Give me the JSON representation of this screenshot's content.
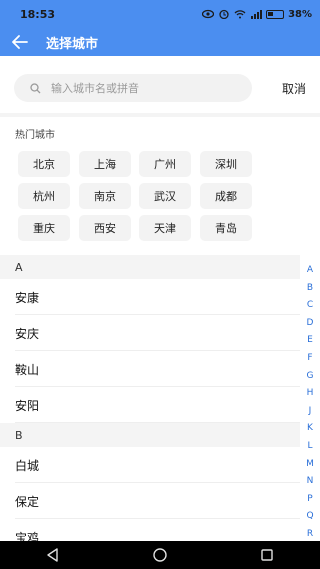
{
  "status_bar": {
    "time": "18:53",
    "battery": "38%",
    "icons": [
      "eye-icon",
      "alarm-icon",
      "wifi-icon",
      "signal-icon",
      "battery-icon"
    ]
  },
  "header": {
    "title": "选择城市",
    "back_icon": "arrow-left-icon",
    "background_color": "#4b8ef0"
  },
  "search": {
    "placeholder": "输入城市名或拼音",
    "value": "",
    "icon": "search-icon",
    "cancel_label": "取消"
  },
  "hot_cities": {
    "title": "热门城市",
    "items": [
      "北京",
      "上海",
      "广州",
      "深圳",
      "杭州",
      "南京",
      "武汉",
      "成都",
      "重庆",
      "西安",
      "天津",
      "青岛"
    ]
  },
  "sections": [
    {
      "letter": "A",
      "cities": [
        "安康",
        "安庆",
        "鞍山",
        "安阳"
      ]
    },
    {
      "letter": "B",
      "cities": [
        "白城",
        "保定",
        "宝鸡"
      ]
    }
  ],
  "index_letters": [
    "A",
    "B",
    "C",
    "D",
    "E",
    "F",
    "G",
    "H",
    "J",
    "K",
    "L",
    "M",
    "N",
    "P",
    "Q",
    "R"
  ],
  "nav_bar": {
    "buttons": [
      "back-triangle-icon",
      "home-circle-icon",
      "recents-square-icon"
    ]
  }
}
